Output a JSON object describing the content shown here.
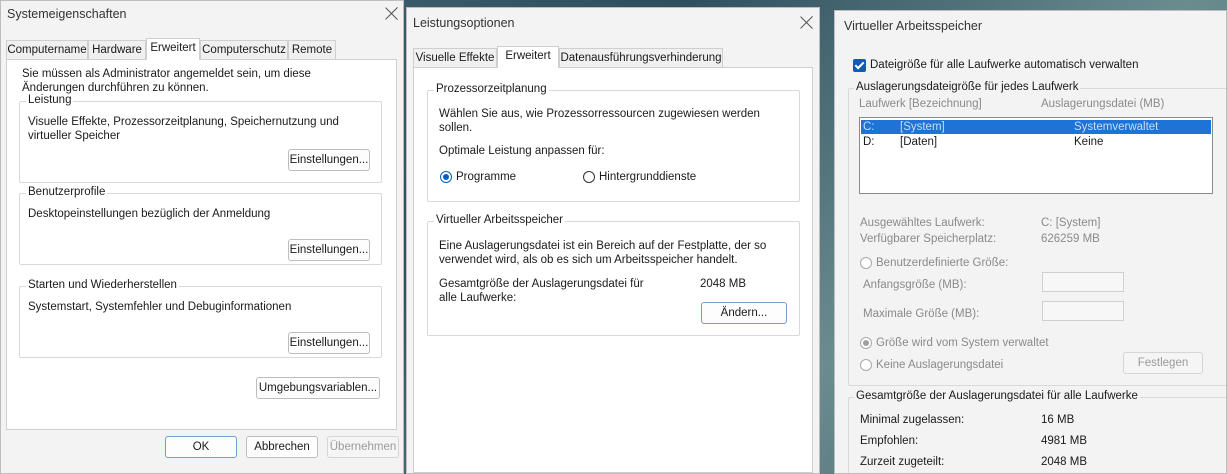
{
  "win1": {
    "title": "Systemeigenschaften",
    "tabs": [
      "Computername",
      "Hardware",
      "Erweitert",
      "Computerschutz",
      "Remote"
    ],
    "admin_note": "Sie müssen als Administrator angemeldet sein, um diese Änderungen durchführen zu können.",
    "performance": {
      "label": "Leistung",
      "desc": "Visuelle Effekte, Prozessorzeitplanung, Speichernutzung und virtueller Speicher",
      "button": "Einstellungen..."
    },
    "profiles": {
      "label": "Benutzerprofile",
      "desc": "Desktopeinstellungen bezüglich der Anmeldung",
      "button": "Einstellungen..."
    },
    "startup": {
      "label": "Starten und Wiederherstellen",
      "desc": "Systemstart, Systemfehler und Debuginformationen",
      "button": "Einstellungen..."
    },
    "env_button": "Umgebungsvariablen...",
    "ok": "OK",
    "cancel": "Abbrechen",
    "apply": "Übernehmen"
  },
  "win2": {
    "title": "Leistungsoptionen",
    "tabs": [
      "Visuelle Effekte",
      "Erweitert",
      "Datenausführungsverhinderung"
    ],
    "cpu": {
      "label": "Prozessorzeitplanung",
      "desc": "Wählen Sie aus, wie Prozessorressourcen zugewiesen werden sollen.",
      "optimize": "Optimale Leistung anpassen für:",
      "opt_programs": "Programme",
      "opt_services": "Hintergrunddienste"
    },
    "vm": {
      "label": "Virtueller Arbeitsspeicher",
      "desc": "Eine Auslagerungsdatei ist ein Bereich auf der Festplatte, der so verwendet wird, als ob es sich um Arbeitsspeicher handelt.",
      "total_label": "Gesamtgröße der Auslagerungsdatei für alle Laufwerke:",
      "total_value": "2048 MB",
      "change_button": "Ändern..."
    }
  },
  "win3": {
    "title": "Virtueller Arbeitsspeicher",
    "auto_manage": "Dateigröße für alle Laufwerke automatisch verwalten",
    "per_drive_label": "Auslagerungsdateigröße für jedes Laufwerk",
    "col_drive": "Laufwerk [Bezeichnung]",
    "col_pagefile": "Auslagerungsdatei (MB)",
    "drives": [
      {
        "drive": "C:",
        "label": "[System]",
        "pagefile": "Systemverwaltet"
      },
      {
        "drive": "D:",
        "label": "[Daten]",
        "pagefile": "Keine"
      }
    ],
    "selected_drive_label": "Ausgewähltes Laufwerk:",
    "selected_drive_value": "C:  [System]",
    "free_space_label": "Verfügbarer Speicherplatz:",
    "free_space_value": "626259 MB",
    "custom_size": "Benutzerdefinierte Größe:",
    "initial_size": "Anfangsgröße (MB):",
    "max_size": "Maximale Größe (MB):",
    "system_managed": "Größe wird vom System verwaltet",
    "no_pagefile": "Keine Auslagerungsdatei",
    "set_button": "Festlegen",
    "total_group": "Gesamtgröße der Auslagerungsdatei für alle Laufwerke",
    "min_label": "Minimal zugelassen:",
    "min_value": "16 MB",
    "recommended_label": "Empfohlen:",
    "recommended_value": "4981 MB",
    "current_label": "Zurzeit zugeteilt:",
    "current_value": "2048 MB"
  }
}
